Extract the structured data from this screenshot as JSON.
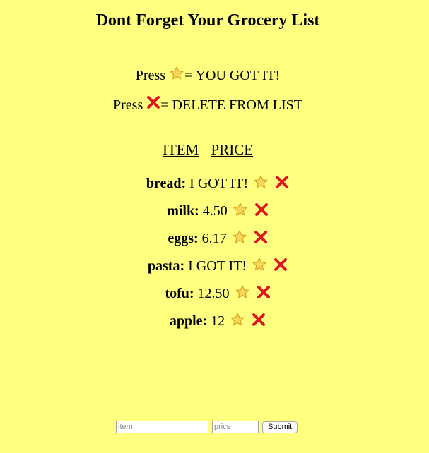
{
  "page": {
    "title": "Dont Forget Your Grocery List",
    "background_color": "#ffff80"
  },
  "instructions": [
    {
      "prefix": "Press ",
      "icon": "star-icon",
      "text": "= YOU GOT IT!"
    },
    {
      "prefix": "Press ",
      "icon": "x-icon",
      "text": "= DELETE FROM LIST"
    }
  ],
  "headers": {
    "item": "ITEM",
    "price": "PRICE"
  },
  "items": [
    {
      "name": "bread:",
      "value": "I GOT IT!"
    },
    {
      "name": "milk:",
      "value": "4.50"
    },
    {
      "name": "eggs:",
      "value": "6.17"
    },
    {
      "name": "pasta:",
      "value": "I GOT IT!"
    },
    {
      "name": "tofu:",
      "value": "12.50"
    },
    {
      "name": "apple:",
      "value": "12"
    }
  ],
  "form": {
    "item_placeholder": "item",
    "item_value": "",
    "price_placeholder": "price",
    "price_value": "",
    "submit_label": "Submit"
  },
  "icons": {
    "star": "star-icon",
    "delete": "x-icon",
    "star_color": "#f7d04a",
    "x_color": "#e0161f"
  }
}
